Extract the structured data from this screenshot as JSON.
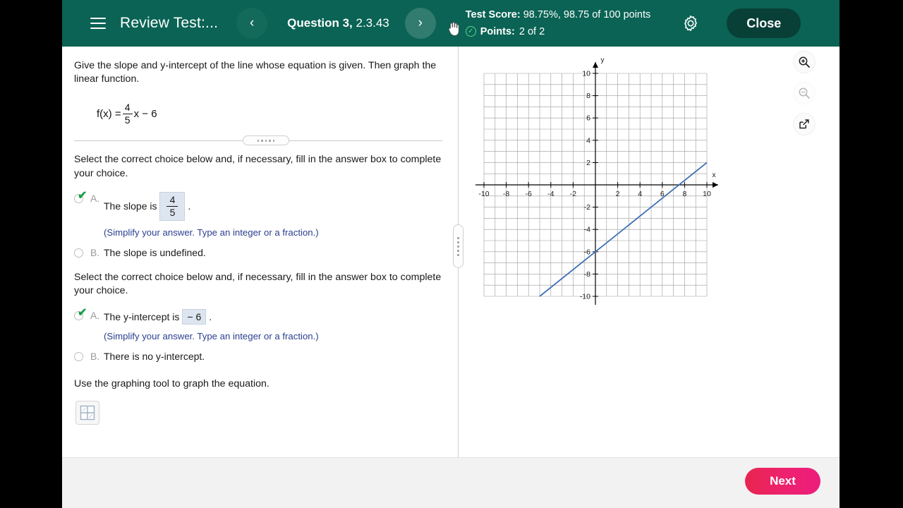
{
  "header": {
    "menu_icon": "hamburger-icon",
    "review_title": "Review Test:...",
    "prev_icon": "‹",
    "next_icon": "›",
    "question_label": "Question 3,",
    "question_number": "2.3.43",
    "test_score_label": "Test Score:",
    "test_score_value": "98.75%, 98.75 of 100 points",
    "points_label": "Points:",
    "points_value": "2 of 2",
    "points_status_icon": "check-circle-icon",
    "settings_icon": "gear-icon",
    "close_label": "Close",
    "bar_color": "#0a6354",
    "close_color": "#083f37"
  },
  "question": {
    "stem": "Give the slope and y-intercept of the line whose equation is given. Then graph the linear function.",
    "equation": {
      "lhs": "f(x) =",
      "numerator": "4",
      "denominator": "5",
      "rhs": "x − 6"
    },
    "section1": {
      "prompt": "Select the correct choice below and, if necessary, fill in the answer box to complete your choice.",
      "choices": [
        {
          "letter": "A.",
          "selected": true,
          "correct": true,
          "text_before": "The slope is",
          "answer_numerator": "4",
          "answer_denominator": "5",
          "text_after": ".",
          "hint": "(Simplify your answer. Type an integer or a fraction.)"
        },
        {
          "letter": "B.",
          "selected": false,
          "correct": false,
          "text": "The slope is undefined."
        }
      ]
    },
    "section2": {
      "prompt": "Select the correct choice below and, if necessary, fill in the answer box to complete your choice.",
      "choices": [
        {
          "letter": "A.",
          "selected": true,
          "correct": true,
          "text_before": "The y-intercept is",
          "answer_value": "− 6",
          "text_after": ".",
          "hint": "(Simplify your answer. Type an integer or a fraction.)"
        },
        {
          "letter": "B.",
          "selected": false,
          "correct": false,
          "text": "There is no y-intercept."
        }
      ]
    },
    "graph_instruction": "Use the graphing tool to graph the equation.",
    "graph_tool_icon": "four-quadrant-grid-icon"
  },
  "graph_tools": [
    {
      "name": "zoom-in-icon",
      "enabled": true
    },
    {
      "name": "zoom-out-icon",
      "enabled": false
    },
    {
      "name": "expand-popout-icon",
      "enabled": true
    }
  ],
  "footer": {
    "next_label": "Next",
    "next_color": "#ec1d7c"
  },
  "chart_data": {
    "type": "line",
    "title": "",
    "xlabel": "x",
    "ylabel": "y",
    "xlim": [
      -10,
      10
    ],
    "ylim": [
      -10,
      10
    ],
    "grid": true,
    "grid_step": 1,
    "tick_step": 2,
    "x_ticks": [
      -10,
      -8,
      -6,
      -4,
      -2,
      2,
      4,
      6,
      8,
      10
    ],
    "y_ticks": [
      -10,
      -8,
      -6,
      -4,
      -2,
      2,
      4,
      6,
      8,
      10
    ],
    "legend": "none",
    "series": [
      {
        "name": "f(x) = (4/5)x - 6",
        "color": "#3f6fb5",
        "slope": 0.8,
        "intercept": -6,
        "points": [
          [
            -5,
            -10
          ],
          [
            0,
            -6
          ],
          [
            5,
            -2
          ],
          [
            10,
            2
          ]
        ]
      }
    ]
  }
}
